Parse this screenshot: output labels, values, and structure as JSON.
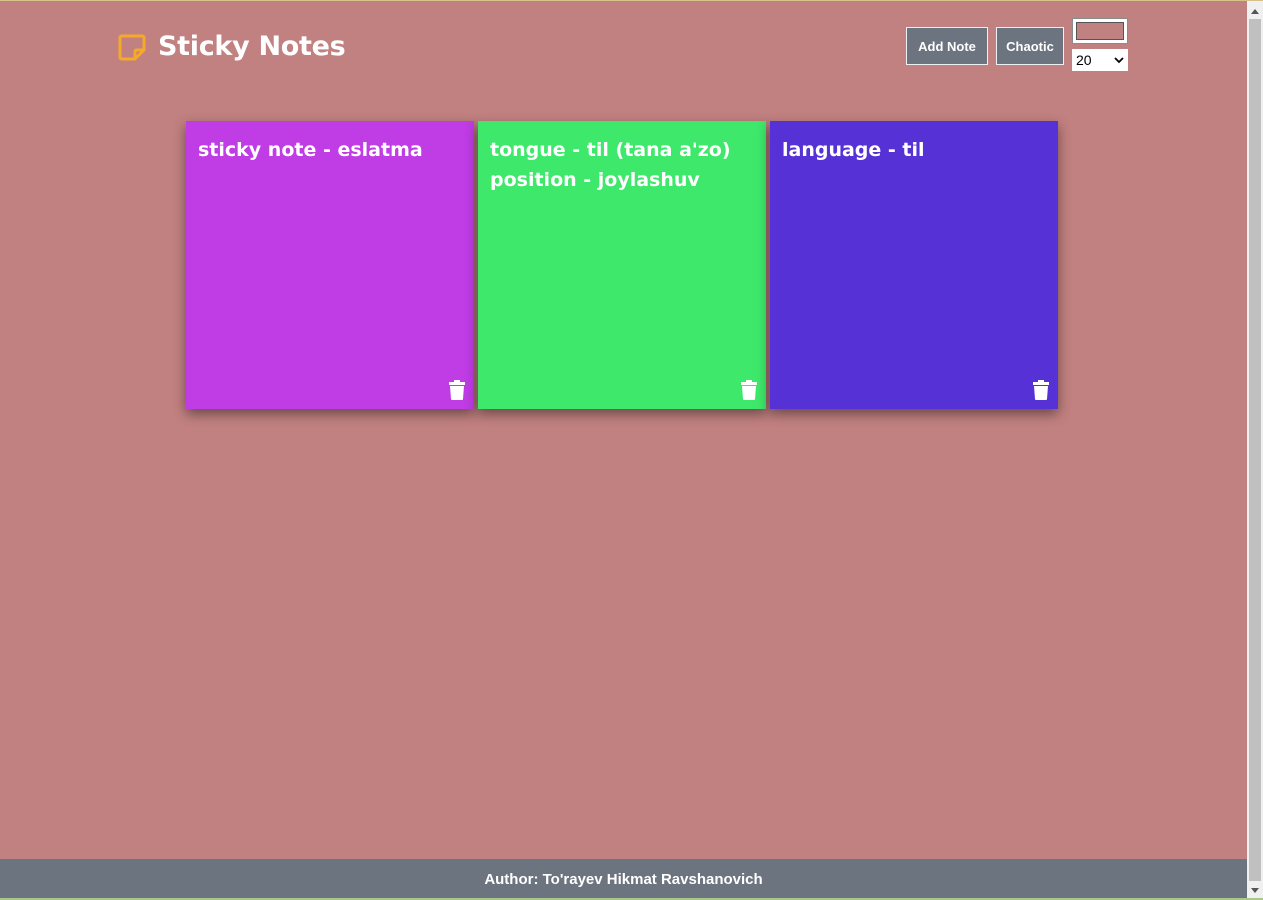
{
  "app": {
    "title": "Sticky Notes",
    "background_color": "#c28181",
    "logo_icon": "sticky-note-icon",
    "logo_color": "#f4a928"
  },
  "controls": {
    "add_note_label": "Add Note",
    "chaotic_label": "Chaotic",
    "color_value": "#c28181",
    "font_size_selected": "20"
  },
  "notes": [
    {
      "lines": [
        "sticky note - eslatma"
      ],
      "color": "#c03ce5",
      "delete_icon": "trash-icon"
    },
    {
      "lines": [
        "tongue - til (tana a'zo)",
        "position - joylashuv"
      ],
      "color": "#3de86a",
      "delete_icon": "trash-icon"
    },
    {
      "lines": [
        "language - til"
      ],
      "color": "#5632d6",
      "delete_icon": "trash-icon"
    }
  ],
  "footer": {
    "text": "Author: To'rayev Hikmat Ravshanovich",
    "color": "#6c7480"
  }
}
